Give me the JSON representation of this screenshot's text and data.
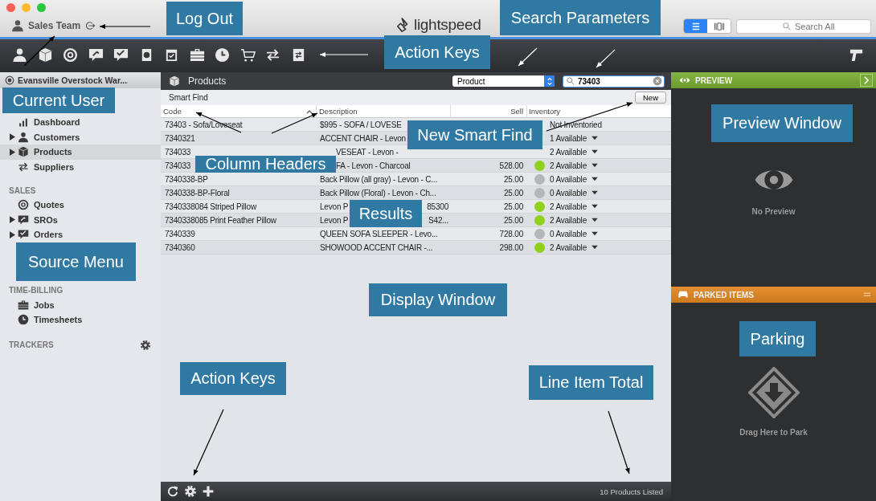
{
  "title_bar": {
    "user": "Sales Team",
    "logo": "lightspeed",
    "view_toggle": [
      {
        "selected": true
      },
      {
        "selected": false
      }
    ],
    "search": {
      "placeholder": "Search All"
    }
  },
  "sidebar": {
    "location": "Evansville Overstock War...",
    "sections": [
      {
        "items": [
          {
            "label": "Dashboard",
            "expandable": false,
            "selected": false
          },
          {
            "label": "Customers",
            "expandable": true,
            "selected": false
          },
          {
            "label": "Products",
            "expandable": true,
            "selected": true
          },
          {
            "label": "Suppliers",
            "expandable": false,
            "selected": false
          }
        ]
      },
      {
        "title": "SALES",
        "items": [
          {
            "label": "Quotes",
            "expandable": false,
            "selected": false
          },
          {
            "label": "SROs",
            "expandable": true,
            "selected": false
          },
          {
            "label": "Orders",
            "expandable": true,
            "selected": false
          }
        ]
      },
      {
        "title": "TIME-BILLING",
        "items": [
          {
            "label": "Jobs",
            "expandable": false,
            "selected": false
          },
          {
            "label": "Timesheets",
            "expandable": false,
            "selected": false
          }
        ]
      },
      {
        "title": "TRACKERS"
      }
    ]
  },
  "products": {
    "title": "Products",
    "filter": {
      "value": "Product"
    },
    "search": {
      "value": "73403"
    },
    "smart_find": "Smart Find",
    "new_button": "New",
    "columns": [
      "Code",
      "Description",
      "Sell",
      "Inventory"
    ],
    "rows": [
      {
        "code": "73403 - Sofa/Loveseat",
        "description": "$995 - SOFA / LOVESE",
        "inventory": "Not Inventoried",
        "dropdown": false
      },
      {
        "code": "7340321",
        "description": "ACCENT CHAIR - Levon",
        "inventory": "1 Available",
        "dropdown": true
      },
      {
        "code": "734033",
        "description": "VESEAT -  Levon -",
        "lead_hidden": true,
        "inventory": "2 Available",
        "dropdown": true
      },
      {
        "code": "734033",
        "description": "FA -  Levon - Charcoal",
        "lead_hidden": true,
        "sell": "528.00",
        "in_stock": true,
        "inventory": "2 Available",
        "dropdown": true
      },
      {
        "code": "7340338-BP",
        "description": "Back Pillow (all gray) - Levon - C...",
        "sell": "25.00",
        "in_stock": false,
        "inventory": "0 Available",
        "dropdown": true
      },
      {
        "code": "7340338-BP-Floral",
        "description": "Back Pillow (Floral) - Levon - Ch...",
        "sell": "25.00",
        "in_stock": false,
        "inventory": "0 Available",
        "dropdown": true
      },
      {
        "code": "7340338084 Striped Pillow",
        "description": "Levon P",
        "description_tail": "85300",
        "sell": "25.00",
        "in_stock": true,
        "inventory": "2 Available",
        "dropdown": true
      },
      {
        "code": "7340338085 Print Feather Pillow",
        "description": "Levon P",
        "description_tail": "S42...",
        "sell": "25.00",
        "in_stock": true,
        "inventory": "2 Available",
        "dropdown": true
      },
      {
        "code": "7340339",
        "description": "QUEEN SOFA SLEEPER - Levo...",
        "sell": "728.00",
        "in_stock": false,
        "inventory": "0 Available",
        "dropdown": true
      },
      {
        "code": "7340360",
        "description": "SHOWOOD ACCENT CHAIR -...",
        "sell": "298.00",
        "in_stock": true,
        "inventory": "2 Available",
        "dropdown": true
      }
    ],
    "footer": "10 Products Listed"
  },
  "preview": {
    "title": "PREVIEW",
    "empty": "No Preview"
  },
  "parked": {
    "title": "PARKED ITEMS",
    "hint": "Drag Here to Park"
  },
  "annotations": [
    {
      "label": "Log Out"
    },
    {
      "label": "Search Parameters"
    },
    {
      "label": "Action Keys"
    },
    {
      "label": "Current User"
    },
    {
      "label": "Preview Window"
    },
    {
      "label": "New Smart Find"
    },
    {
      "label": "Column Headers"
    },
    {
      "label": "Results"
    },
    {
      "label": "Source Menu"
    },
    {
      "label": "Display Window"
    },
    {
      "label": "Parking"
    },
    {
      "label": "Action Keys"
    },
    {
      "label": "Line Item Total"
    }
  ]
}
